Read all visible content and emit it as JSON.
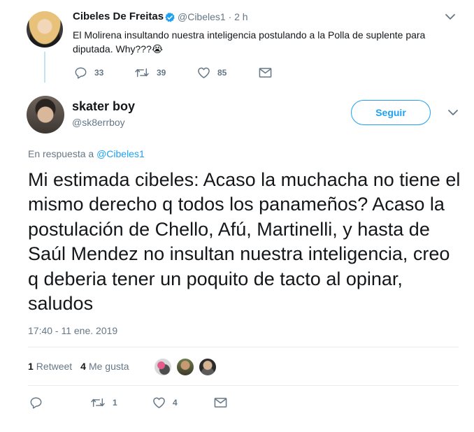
{
  "parent_tweet": {
    "name": "Cibeles De Freitas",
    "handle": "@Cibeles1",
    "time": "· 2 h",
    "text": "El Molirena insultando nuestra inteligencia postulando a la Polla de suplente para diputada. Why???😭",
    "replies": "33",
    "retweets": "39",
    "likes": "85",
    "icons": [
      "verified-badge-icon",
      "chevron-down-icon",
      "reply-icon",
      "retweet-icon",
      "heart-icon",
      "message-icon"
    ]
  },
  "main_tweet": {
    "name": "skater boy",
    "handle": "@sk8errboy",
    "follow_label": "Seguir",
    "reply_prefix": "En respuesta a ",
    "reply_handle": "@Cibeles1",
    "text": "Mi estimada cibeles: Acaso la muchacha no tiene el mismo derecho q todos los panameños? Acaso la postulación de Chello, Afú, Martinelli, y hasta de Saúl Mendez no insultan nuestra inteligencia, creo q deberia tener un poquito de tacto al opinar, saludos",
    "timestamp": "17:40 - 11 ene. 2019",
    "retweet_count": "1",
    "retweet_label": "Retweet",
    "like_count": "4",
    "like_label": "Me gusta",
    "action_retweets": "1",
    "action_likes": "4"
  },
  "colors": {
    "accent": "#1da1f2",
    "secondary_text": "#657786",
    "primary_text": "#14171a",
    "divider": "#e6ecf0",
    "thread_line": "#c4e0f3"
  }
}
